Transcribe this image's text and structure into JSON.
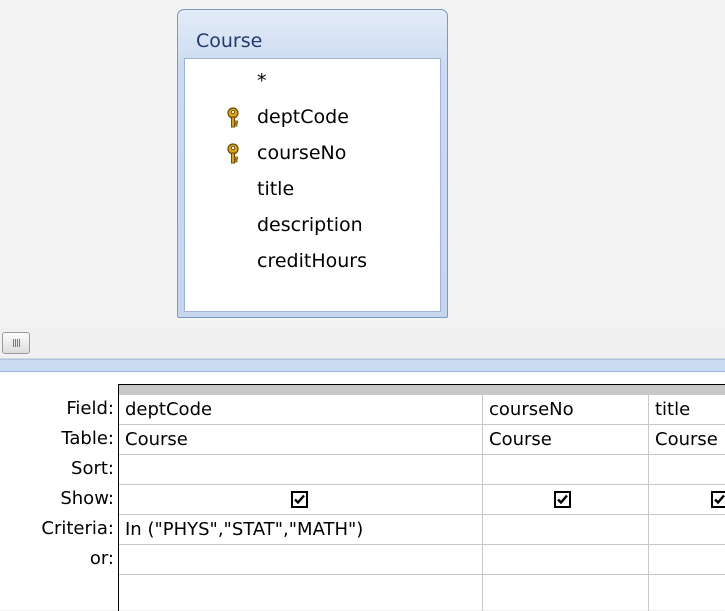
{
  "table": {
    "name": "Course",
    "fields": [
      {
        "label": "*",
        "key": false
      },
      {
        "label": "deptCode",
        "key": true
      },
      {
        "label": "courseNo",
        "key": true
      },
      {
        "label": "title",
        "key": false
      },
      {
        "label": "description",
        "key": false
      },
      {
        "label": "creditHours",
        "key": false
      }
    ]
  },
  "grid": {
    "row_labels": [
      "Field:",
      "Table:",
      "Sort:",
      "Show:",
      "Criteria:",
      "or:"
    ],
    "columns": [
      {
        "field": "deptCode",
        "table": "Course",
        "sort": "",
        "show": true,
        "criteria": "In (\"PHYS\",\"STAT\",\"MATH\")",
        "or": ""
      },
      {
        "field": "courseNo",
        "table": "Course",
        "sort": "",
        "show": true,
        "criteria": "",
        "or": ""
      },
      {
        "field": "title",
        "table": "Course",
        "sort": "",
        "show": true,
        "criteria": "",
        "or": ""
      }
    ]
  },
  "icons": {
    "primary_key": "key-icon",
    "show_checkbox": "checkbox-checked-icon",
    "scroll_thumb": "scroll-thumb-icon"
  },
  "colors": {
    "table_header": "#cbdaf0",
    "divider": "#c9dcf2",
    "key_gold": "#d9a520"
  }
}
